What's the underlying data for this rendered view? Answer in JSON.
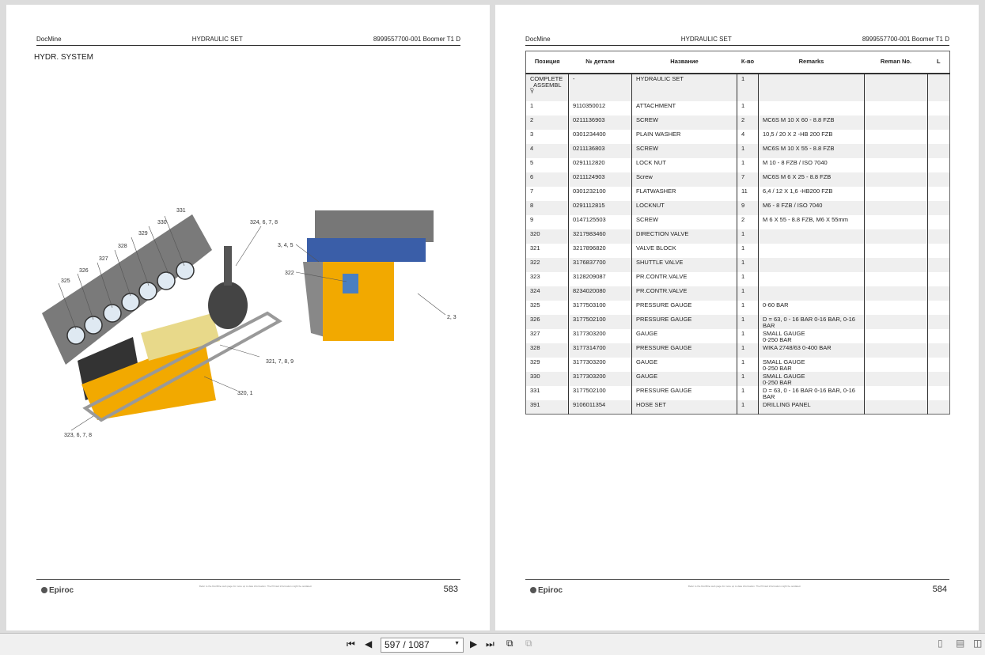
{
  "pages": [
    {
      "header_left": "DocMine",
      "header_center": "HYDRAULIC SET",
      "header_right": "8999557700-001 Boomer T1 D",
      "title": "HYDR. SYSTEM",
      "logo": "Epiroc",
      "footer_note": "Refer to the DocMine web page for more up to date information. The Printed information might be outdated.",
      "page_number": "583"
    },
    {
      "header_left": "DocMine",
      "header_center": "HYDRAULIC SET",
      "header_right": "8999557700-001 Boomer T1 D",
      "logo": "Epiroc",
      "footer_note": "Refer to the DocMine web page for more up to date information. The Printed information might be outdated.",
      "page_number": "584"
    }
  ],
  "callouts": [
    "331",
    "330",
    "329",
    "328",
    "327",
    "326",
    "325",
    "324, 6, 7, 8",
    "3, 4, 5",
    "322",
    "2, 3",
    "321, 7, 8, 9",
    "320, 1",
    "323, 6, 7, 8"
  ],
  "table": {
    "columns": [
      "Позиция",
      "№ детали",
      "Название",
      "К-во",
      "Remarks",
      "Reman No.",
      "L"
    ],
    "rows": [
      [
        "COMPLETE_ASSEMBLY",
        "-",
        "HYDRAULIC SET",
        "1",
        "",
        "",
        ""
      ],
      [
        "1",
        "9110350012",
        "ATTACHMENT",
        "1",
        "",
        "",
        ""
      ],
      [
        "2",
        "0211136903",
        "SCREW",
        "2",
        "MC6S M 10 X 60 - 8.8 FZB",
        "",
        ""
      ],
      [
        "3",
        "0301234400",
        "PLAIN WASHER",
        "4",
        "10,5 / 20 X 2 -HB 200 FZB",
        "",
        ""
      ],
      [
        "4",
        "0211136803",
        "SCREW",
        "1",
        "MC6S M 10 X 55 - 8.8 FZB",
        "",
        ""
      ],
      [
        "5",
        "0291112820",
        "LOCK NUT",
        "1",
        "M 10 - 8 FZB / ISO 7040",
        "",
        ""
      ],
      [
        "6",
        "0211124903",
        "Screw",
        "7",
        "MC6S M 6 X 25 - 8.8 FZB",
        "",
        ""
      ],
      [
        "7",
        "0301232100",
        "FLATWASHER",
        "11",
        "6,4 / 12 X 1,6 -HB200 FZB",
        "",
        ""
      ],
      [
        "8",
        "0291112815",
        "LOCKNUT",
        "9",
        "M6 - 8 FZB / ISO 7040",
        "",
        ""
      ],
      [
        "9",
        "0147125503",
        "SCREW",
        "2",
        "M 6 X 55 - 8.8 FZB, M6 X 55mm",
        "",
        ""
      ],
      [
        "320",
        "3217983460",
        "DIRECTION VALVE",
        "1",
        "",
        "",
        ""
      ],
      [
        "321",
        "3217896820",
        "VALVE BLOCK",
        "1",
        "",
        "",
        ""
      ],
      [
        "322",
        "3176837700",
        "SHUTTLE VALVE",
        "1",
        "",
        "",
        ""
      ],
      [
        "323",
        "3128209087",
        "PR.CONTR.VALVE",
        "1",
        "",
        "",
        ""
      ],
      [
        "324",
        "8234020080",
        "PR.CONTR.VALVE",
        "1",
        "",
        "",
        ""
      ],
      [
        "325",
        "3177503100",
        "PRESSURE GAUGE",
        "1",
        "0-60 BAR",
        "",
        ""
      ],
      [
        "326",
        "3177502100",
        "PRESSURE GAUGE",
        "1",
        "D = 63, 0 - 16 BAR  0-16 BAR, 0-16 BAR",
        "",
        ""
      ],
      [
        "327",
        "3177303200",
        "GAUGE",
        "1",
        "SMALL GAUGE\n0-250 BAR",
        "",
        ""
      ],
      [
        "328",
        "3177314700",
        "PRESSURE GAUGE",
        "1",
        "WIKA 2748/63 0-400 BAR",
        "",
        ""
      ],
      [
        "329",
        "3177303200",
        "GAUGE",
        "1",
        "SMALL GAUGE\n0-250 BAR",
        "",
        ""
      ],
      [
        "330",
        "3177303200",
        "GAUGE",
        "1",
        "SMALL GAUGE\n0-250 BAR",
        "",
        ""
      ],
      [
        "331",
        "3177502100",
        "PRESSURE GAUGE",
        "1",
        "D = 63, 0 - 16 BAR  0-16 BAR, 0-16 BAR",
        "",
        ""
      ],
      [
        "391",
        "9106011354",
        "HOSE SET",
        "1",
        "DRILLING PANEL",
        "",
        ""
      ]
    ]
  },
  "toolbar": {
    "page_field": "597 / 1087"
  }
}
